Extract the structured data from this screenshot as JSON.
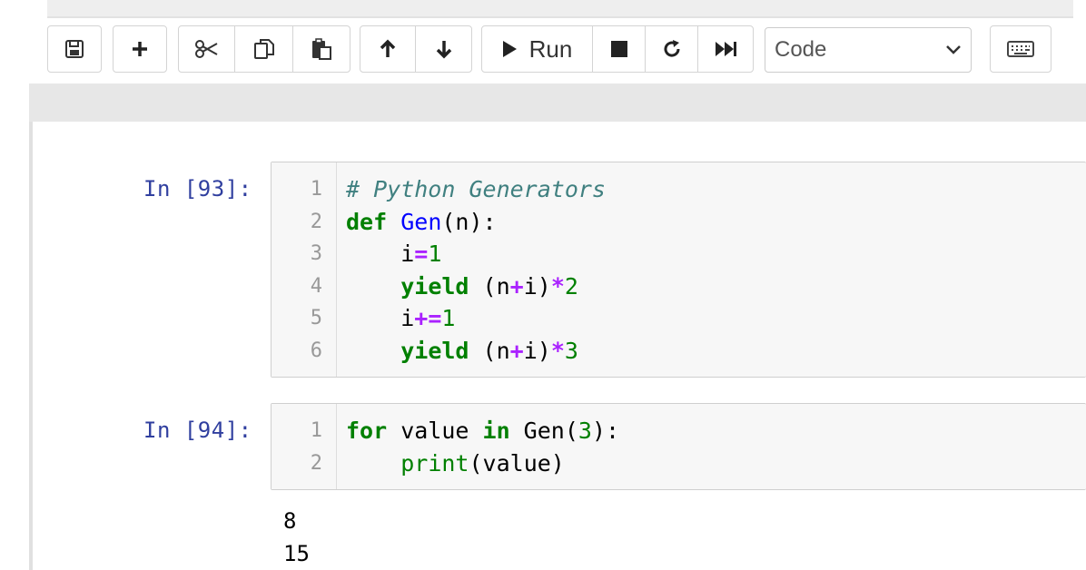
{
  "toolbar": {
    "buttons": {
      "save": "save-icon",
      "insert": "plus-icon",
      "cut": "scissors-icon",
      "copy": "copy-icon",
      "paste": "paste-icon",
      "move_up": "arrow-up-icon",
      "move_down": "arrow-down-icon",
      "run": "play-icon",
      "interrupt": "stop-icon",
      "restart": "restart-icon",
      "restart_run_all": "fast-forward-icon",
      "command_palette": "keyboard-icon"
    },
    "run_label": "Run",
    "cell_type": {
      "selected": "Code"
    }
  },
  "cells": [
    {
      "prompt": "In [93]:",
      "line_numbers": [
        "1",
        "2",
        "3",
        "4",
        "5",
        "6"
      ],
      "lines": [
        [
          {
            "text": "# Python Generators",
            "cls": "t-comment"
          }
        ],
        [
          {
            "text": "def",
            "cls": "t-keyword"
          },
          {
            "text": " ",
            "cls": "t-var"
          },
          {
            "text": "Gen",
            "cls": "t-def"
          },
          {
            "text": "(n):",
            "cls": "t-var"
          }
        ],
        [
          {
            "text": "    i",
            "cls": "t-var"
          },
          {
            "text": "=",
            "cls": "t-op"
          },
          {
            "text": "1",
            "cls": "t-num"
          }
        ],
        [
          {
            "text": "    ",
            "cls": "t-var"
          },
          {
            "text": "yield",
            "cls": "t-keyword"
          },
          {
            "text": " (n",
            "cls": "t-var"
          },
          {
            "text": "+",
            "cls": "t-op"
          },
          {
            "text": "i)",
            "cls": "t-var"
          },
          {
            "text": "*",
            "cls": "t-op"
          },
          {
            "text": "2",
            "cls": "t-num"
          }
        ],
        [
          {
            "text": "    i",
            "cls": "t-var"
          },
          {
            "text": "+=",
            "cls": "t-op"
          },
          {
            "text": "1",
            "cls": "t-num"
          }
        ],
        [
          {
            "text": "    ",
            "cls": "t-var"
          },
          {
            "text": "yield",
            "cls": "t-keyword"
          },
          {
            "text": " (n",
            "cls": "t-var"
          },
          {
            "text": "+",
            "cls": "t-op"
          },
          {
            "text": "i)",
            "cls": "t-var"
          },
          {
            "text": "*",
            "cls": "t-op"
          },
          {
            "text": "3",
            "cls": "t-num"
          }
        ]
      ],
      "outputs": []
    },
    {
      "prompt": "In [94]:",
      "line_numbers": [
        "1",
        "2"
      ],
      "lines": [
        [
          {
            "text": "for",
            "cls": "t-keyword"
          },
          {
            "text": " value ",
            "cls": "t-var"
          },
          {
            "text": "in",
            "cls": "t-keyword"
          },
          {
            "text": " Gen(",
            "cls": "t-var"
          },
          {
            "text": "3",
            "cls": "t-num"
          },
          {
            "text": "):",
            "cls": "t-var"
          }
        ],
        [
          {
            "text": "    ",
            "cls": "t-var"
          },
          {
            "text": "print",
            "cls": "t-builtin"
          },
          {
            "text": "(value)",
            "cls": "t-var"
          }
        ]
      ],
      "outputs": [
        "8",
        "15"
      ]
    }
  ],
  "colors": {
    "prompt": "#303f9f",
    "comment": "#408080",
    "keyword": "#008000",
    "operator": "#aa22ff",
    "function_name": "#0000ff"
  }
}
